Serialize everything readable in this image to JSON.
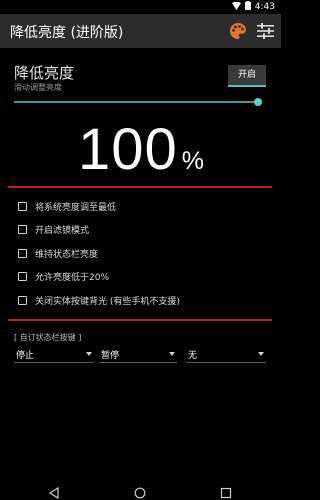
{
  "status_bar": {
    "time": "4:43"
  },
  "app_bar": {
    "title": "降低亮度 (进阶版)"
  },
  "brightness": {
    "heading": "降低亮度",
    "subtitle": "滑动调整亮度",
    "toggle_label": "开启",
    "value": "100",
    "unit": "%",
    "slider_level": 1.0
  },
  "options": [
    {
      "label": "将系统亮度调至最低",
      "checked": false
    },
    {
      "label": "开启滤镜模式",
      "checked": false
    },
    {
      "label": "维持状态栏亮度",
      "checked": false
    },
    {
      "label": "允许亮度低于20%",
      "checked": false
    },
    {
      "label": "关闭实体按键背光 (有些手机不支援)",
      "checked": false
    }
  ],
  "custom_statusbar": {
    "label": "[ 自订状态栏按键 ]",
    "selects": [
      "停止",
      "暂停",
      "无"
    ]
  },
  "colors": {
    "accent": "#4fc3c3",
    "divider": "#c0201c",
    "palette_icon": "#e8752a"
  }
}
